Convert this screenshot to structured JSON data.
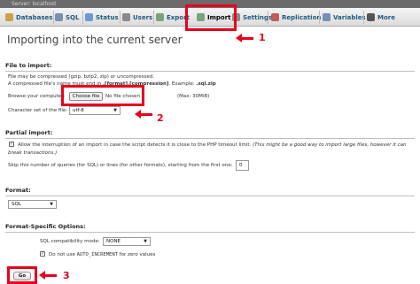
{
  "breadcrumb": "Server: localhost",
  "tabs": [
    {
      "label": "Databases",
      "icon": "database-icon",
      "color": "#c9a24a"
    },
    {
      "label": "SQL",
      "icon": "sql-icon",
      "color": "#7a8fb5"
    },
    {
      "label": "Status",
      "icon": "status-icon",
      "color": "#6c9bd2"
    },
    {
      "label": "Users",
      "icon": "users-icon",
      "color": "#8a8a8a"
    },
    {
      "label": "Export",
      "icon": "export-icon",
      "color": "#7aa37a"
    },
    {
      "label": "Import",
      "icon": "import-icon",
      "color": "#7aa37a"
    },
    {
      "label": "Settings",
      "icon": "wrench-icon",
      "color": "#8a8a8a"
    },
    {
      "label": "Replication",
      "icon": "replication-icon",
      "color": "#c25b5b"
    },
    {
      "label": "Variables",
      "icon": "variables-icon",
      "color": "#7a8fb5"
    },
    {
      "label": "More",
      "icon": "chevron-down-icon",
      "color": "#555"
    }
  ],
  "page_title": "Importing into the current server",
  "file_to_import": {
    "title": "File to import:",
    "desc_line1": "File may be compressed (gzip, bzip2, zip) or uncompressed.",
    "desc_line2a": "A compressed file's name must end in ",
    "desc_line2b": ".[format].[compression]",
    "desc_line2c": ". Example: ",
    "desc_line2d": ".sql.zip",
    "browse_label": "Browse your computer:",
    "choose_file": "Choose file",
    "no_file": "No file chosen",
    "max_size": "(Max: 30MiB)",
    "charset_label": "Character set of the file:",
    "charset_value": "utf-8"
  },
  "partial_import": {
    "title": "Partial import:",
    "allow_line1a": "Allow the interruption of an import in case the script detects it is close to the PHP timeout limit. ",
    "allow_line1b": "(This might be a good way to import large files, however it can",
    "allow_line2": "break transactions.)",
    "skip_label": "Skip this number of queries (for SQL) or lines (for other formats), starting from the first one:",
    "skip_value": "0"
  },
  "format": {
    "title": "Format:",
    "value": "SQL"
  },
  "format_options": {
    "title": "Format-Specific Options:",
    "compat_label": "SQL compatibility mode:",
    "compat_value": "NONE",
    "auto_inc_a": "Do not use ",
    "auto_inc_b": "AUTO_INCREMENT",
    "auto_inc_c": " for zero values"
  },
  "go_label": "Go",
  "annotations": [
    "1",
    "2",
    "3"
  ],
  "colors": {
    "annotation": "#e8001c",
    "link": "#235a81"
  }
}
